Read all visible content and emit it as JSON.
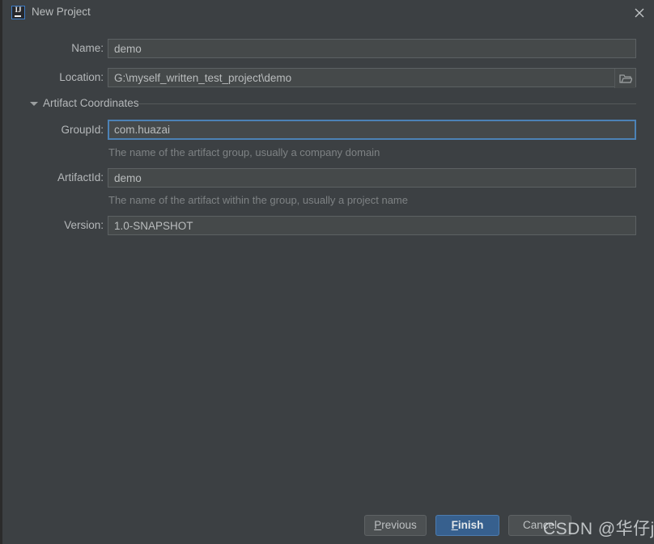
{
  "window": {
    "title": "New Project",
    "app_icon": "intellij-idea-icon",
    "app_icon_text": "IJ",
    "close_icon": "close-icon"
  },
  "form": {
    "name": {
      "label": "Name:",
      "value": "demo"
    },
    "location": {
      "label": "Location:",
      "value": "G:\\myself_written_test_project\\demo",
      "browse_icon": "folder-icon"
    },
    "artifact_section": {
      "title": "Artifact Coordinates",
      "expanded": true,
      "chevron_icon": "chevron-down-icon"
    },
    "group_id": {
      "label": "GroupId:",
      "value": "com.huazai",
      "hint": "The name of the artifact group, usually a company domain",
      "focused": true
    },
    "artifact_id": {
      "label": "ArtifactId:",
      "value": "demo",
      "hint": "The name of the artifact within the group, usually a project name"
    },
    "version": {
      "label": "Version:",
      "value": "1.0-SNAPSHOT"
    }
  },
  "buttons": {
    "previous": {
      "mnemonic": "P",
      "rest": "revious"
    },
    "finish": {
      "mnemonic": "F",
      "rest": "inish"
    },
    "cancel": {
      "label": "Cancel"
    }
  },
  "watermark": {
    "text": "CSDN @华仔java"
  },
  "colors": {
    "background": "#3c4043",
    "field_background": "#45494a",
    "field_border": "#5c6163",
    "focus_border": "#4c82b6",
    "primary_button": "#37608e",
    "text": "#b5b8ba",
    "hint_text": "#7e8284"
  }
}
